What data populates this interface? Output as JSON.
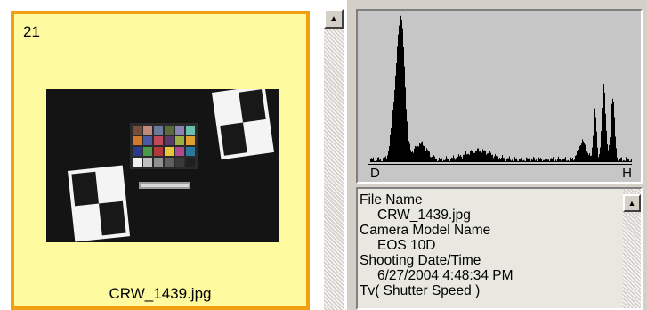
{
  "thumbnail": {
    "index": "21",
    "filename": "CRW_1439.jpg",
    "selected": true,
    "highlight_color": "#fefaa0",
    "border_color": "#f0a010"
  },
  "histogram": {
    "label_left": "D",
    "label_right": "H",
    "background": "#c6c6c6"
  },
  "info": {
    "fields": [
      {
        "label": "File Name",
        "value": "CRW_1439.jpg"
      },
      {
        "label": "Camera Model Name",
        "value": "EOS 10D"
      },
      {
        "label": "Shooting Date/Time",
        "value": "6/27/2004 4:48:34 PM"
      },
      {
        "label": "Tv( Shutter Speed )",
        "value": ""
      }
    ]
  },
  "icons": {
    "scroll_up": "up-arrow-icon"
  }
}
